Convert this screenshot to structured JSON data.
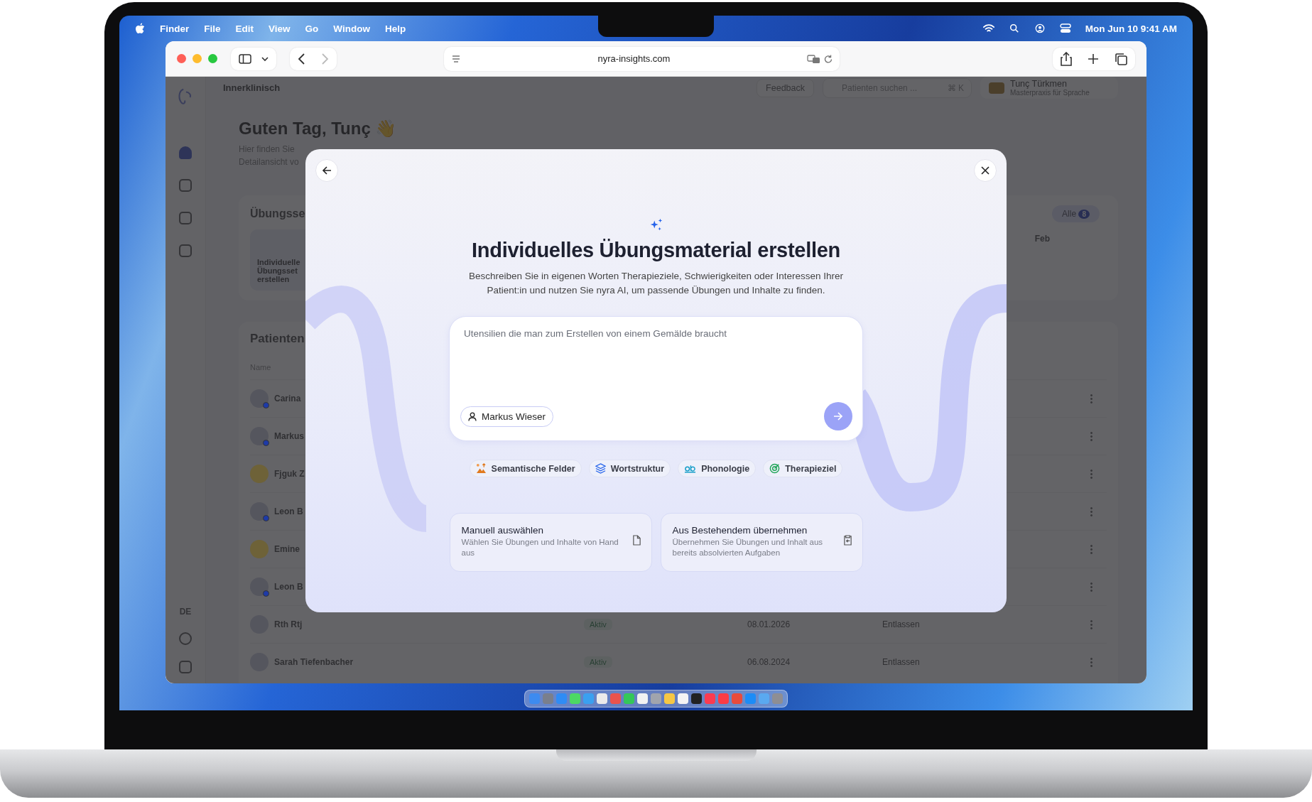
{
  "menu_bar": {
    "app": "Finder",
    "menus": [
      "File",
      "Edit",
      "View",
      "Go",
      "Window",
      "Help"
    ],
    "clock": "Mon Jun 10  9:41 AM"
  },
  "browser": {
    "url": "nyra-insights.com"
  },
  "app": {
    "brand": "Innerklinisch",
    "language": "DE",
    "feedback": "Feedback",
    "search": {
      "placeholder": "Patienten suchen ...",
      "shortcut": "⌘ K"
    },
    "user": {
      "name": "Tunç Türkmen",
      "role": "Masterpraxis für Sprache"
    },
    "greeting": "Guten Tag, Tunç 👋",
    "intro": [
      "Hier finden Sie",
      "Detailansicht vo"
    ],
    "sets": {
      "title": "Übungsse",
      "card_lines": [
        "Individuelle",
        "Übungsset",
        "erstellen"
      ],
      "filter": "Alle",
      "filter_count": "8",
      "month": "Feb"
    },
    "patients": {
      "title": "Patienten",
      "column": "Name",
      "rows": [
        {
          "name": "Carina",
          "color": "#55565e",
          "online": true
        },
        {
          "name": "Markus",
          "color": "#55565e",
          "online": true
        },
        {
          "name": "Fjguk Z",
          "color": "#6e6238",
          "online": false
        },
        {
          "name": "Leon B",
          "color": "#55565e",
          "online": true
        },
        {
          "name": "Emine",
          "color": "#6e6238",
          "online": false
        },
        {
          "name": "Leon B",
          "color": "#55565e",
          "online": true
        },
        {
          "name": "Rth Rtj",
          "color": "#55565e",
          "online": false,
          "badge": "Aktiv",
          "date": "08.01.2026",
          "status": "Entlassen"
        },
        {
          "name": "Sarah Tiefenbacher",
          "color": "#55565e",
          "online": false,
          "badge": "Aktiv",
          "date": "06.08.2024",
          "status": "Entlassen"
        }
      ]
    }
  },
  "modal": {
    "title": "Individuelles Übungsmaterial erstellen",
    "description": "Beschreiben Sie in eigenen Worten Therapieziele, Schwierigkeiten oder Interessen Ihrer Patient:in und nutzen Sie nyra AI, um passende Übungen und Inhalte zu finden.",
    "prompt": {
      "placeholder": "Utensilien die man zum Erstellen von einem Gemälde braucht",
      "patient": "Markus Wieser"
    },
    "chips": [
      {
        "label": "Semantische Felder",
        "kind": "semantic"
      },
      {
        "label": "Wortstruktur",
        "kind": "structure"
      },
      {
        "label": "Phonologie",
        "kind": "phonology"
      },
      {
        "label": "Therapieziel",
        "kind": "goal"
      }
    ],
    "options": [
      {
        "title": "Manuell auswählen",
        "text": "Wählen Sie Übungen und Inhalte von Hand aus",
        "kind": "manual"
      },
      {
        "title": "Aus Bestehendem übernehmen",
        "text": "Übernehmen Sie Übungen und Inhalt aus bereits absolvierten Aufgaben",
        "kind": "copy"
      }
    ]
  }
}
